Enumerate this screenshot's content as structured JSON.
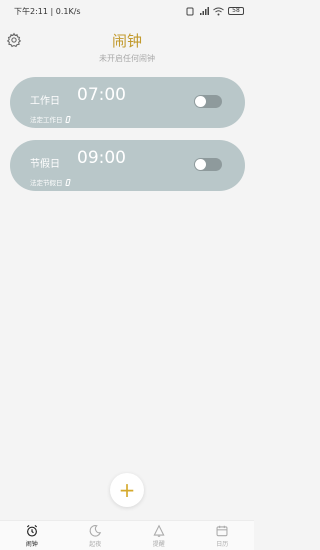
{
  "status_bar": {
    "left_text": "下午2:11 | 0.1K/s",
    "battery": "58"
  },
  "header": {
    "title": "闹钟",
    "subtitle": "未开启任何闹钟",
    "settings_icon": "gear-icon"
  },
  "alarms": [
    {
      "name": "工作日",
      "time": "07:00",
      "sub": "法定工作日",
      "enabled": false
    },
    {
      "name": "节假日",
      "time": "09:00",
      "sub": "法定节假日",
      "enabled": false
    }
  ],
  "fab": {
    "label": "+"
  },
  "tabs": [
    {
      "label": "闹钟",
      "icon": "alarm-clock-icon",
      "active": true
    },
    {
      "label": "起夜",
      "icon": "moon-icon",
      "active": false
    },
    {
      "label": "提醒",
      "icon": "bell-icon",
      "active": false
    },
    {
      "label": "日历",
      "icon": "calendar-icon",
      "active": false
    }
  ],
  "colors": {
    "accent": "#c29a2d",
    "card": "#b9c7c9",
    "toggle_track": "#8e9a9c",
    "background": "#f4f4f4"
  }
}
